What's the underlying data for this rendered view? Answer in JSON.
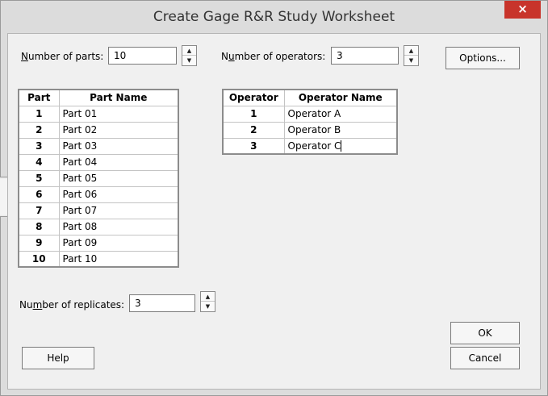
{
  "window": {
    "title": "Create Gage R&R Study Worksheet",
    "close_glyph": "×"
  },
  "parts": {
    "label_prefix": "",
    "label_underlined": "N",
    "label_rest": "umber of parts:",
    "value": "10"
  },
  "operators": {
    "label_prefix": "N",
    "label_underlined": "u",
    "label_rest": "mber of operators:",
    "value": "3"
  },
  "replicates": {
    "label_prefix": "Nu",
    "label_underlined": "m",
    "label_rest": "ber of replicates:",
    "value": "3"
  },
  "buttons": {
    "options": "Options...",
    "ok": "OK",
    "cancel": "Cancel",
    "help": "Help"
  },
  "parts_table": {
    "headers": [
      "Part",
      "Part Name"
    ],
    "rows": [
      [
        "1",
        "Part 01"
      ],
      [
        "2",
        "Part 02"
      ],
      [
        "3",
        "Part 03"
      ],
      [
        "4",
        "Part 04"
      ],
      [
        "5",
        "Part 05"
      ],
      [
        "6",
        "Part 06"
      ],
      [
        "7",
        "Part 07"
      ],
      [
        "8",
        "Part 08"
      ],
      [
        "9",
        "Part 09"
      ],
      [
        "10",
        "Part 10"
      ]
    ]
  },
  "operators_table": {
    "headers": [
      "Operator",
      "Operator Name"
    ],
    "rows": [
      [
        "1",
        "Operator A"
      ],
      [
        "2",
        "Operator B"
      ],
      [
        "3",
        "Operator C"
      ]
    ]
  },
  "colors": {
    "close_button": "#c8342b",
    "window_bg": "#dcdcdc",
    "content_bg": "#f0f0f0"
  }
}
